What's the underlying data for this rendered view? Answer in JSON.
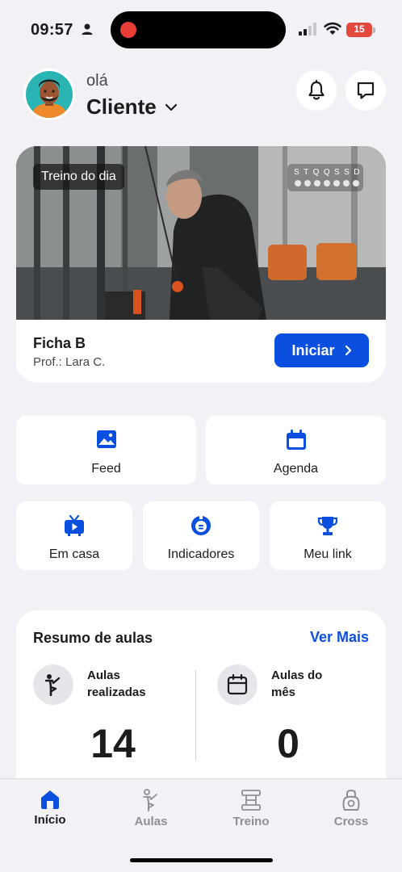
{
  "status_bar": {
    "time": "09:57",
    "battery_level": "15",
    "icons": [
      "person-icon",
      "signal-icon",
      "wifi-icon",
      "battery-icon"
    ]
  },
  "header": {
    "greeting": "olá",
    "client_name": "Cliente",
    "notification_icon": "bell-icon",
    "message_icon": "chat-icon"
  },
  "workout_card": {
    "badge": "Treino do dia",
    "week_days": [
      "S",
      "T",
      "Q",
      "Q",
      "S",
      "S",
      "D"
    ],
    "title": "Ficha B",
    "professor": "Prof.: Lara C.",
    "start_label": "Iniciar"
  },
  "shortcuts": [
    {
      "label": "Feed",
      "icon": "image-icon"
    },
    {
      "label": "Agenda",
      "icon": "calendar-icon"
    },
    {
      "label": "Em casa",
      "icon": "tv-icon"
    },
    {
      "label": "Indicadores",
      "icon": "gauge-icon"
    },
    {
      "label": "Meu link",
      "icon": "trophy-icon"
    }
  ],
  "summary": {
    "title": "Resumo de aulas",
    "see_more": "Ver Mais",
    "stats": [
      {
        "label_line1": "Aulas",
        "label_line2": "realizadas",
        "value": "14",
        "icon": "yoga-pose-icon"
      },
      {
        "label_line1": "Aulas do",
        "label_line2": "mês",
        "value": "0",
        "icon": "calendar-icon"
      }
    ]
  },
  "tab_bar": {
    "tabs": [
      {
        "label": "Início",
        "icon": "home-icon",
        "active": true
      },
      {
        "label": "Aulas",
        "icon": "yoga-pose-icon",
        "active": false
      },
      {
        "label": "Treino",
        "icon": "dumbbell-icon",
        "active": false
      },
      {
        "label": "Cross",
        "icon": "kettlebell-icon",
        "active": false
      }
    ]
  },
  "colors": {
    "accent": "#0a4fe0",
    "background": "#f2f1f6",
    "card": "#ffffff",
    "text": "#1c1c1e",
    "inactive_tab": "#8e8e93"
  }
}
